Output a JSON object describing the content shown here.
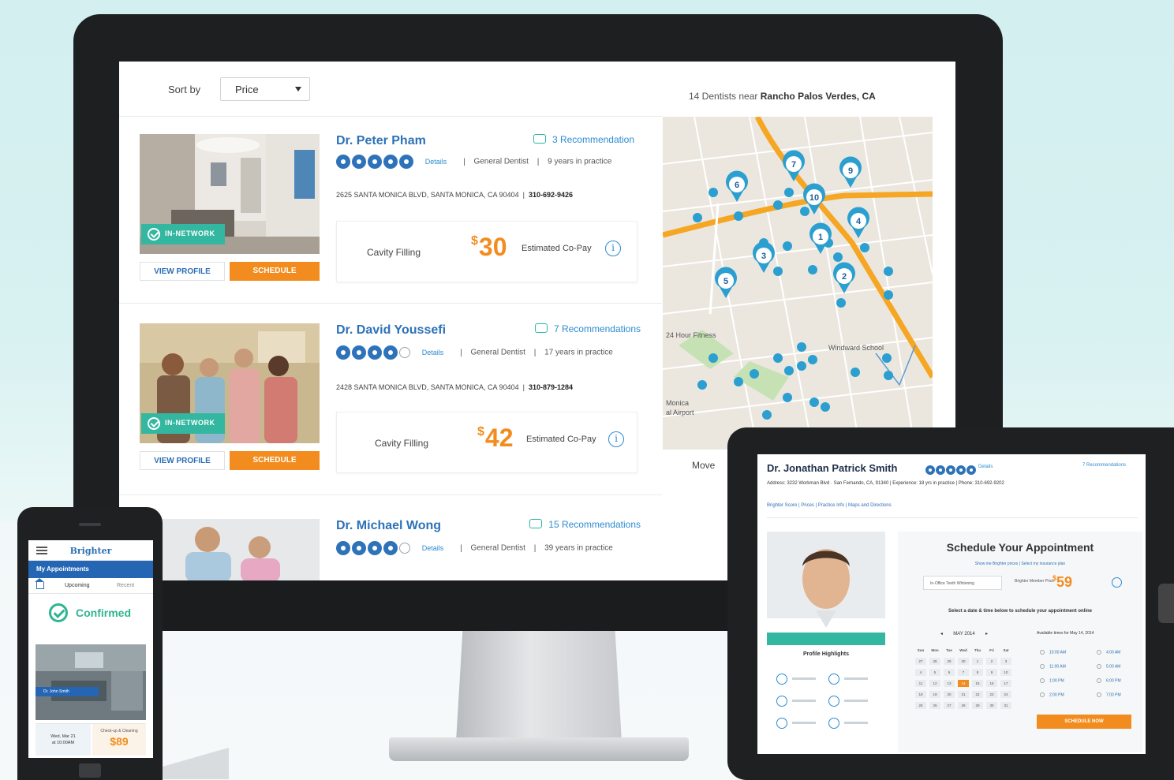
{
  "listing": {
    "sort_label": "Sort by",
    "sort_value": "Price",
    "results_prefix": "14 Dentists near",
    "results_location": "Rancho Palos Verdes, CA",
    "map_move_label": "Move",
    "view_profile_label": "VIEW PROFILE",
    "schedule_label": "SCHEDULE",
    "in_network_label": "IN-NETWORK",
    "details_label": "Details",
    "copay_label": "Estimated Co-Pay",
    "dentists": [
      {
        "name": "Dr. Peter Pham",
        "recommendations": "3 Recommendation",
        "rating": 5,
        "specialty": "General Dentist",
        "experience": "9 years in practice",
        "address": "2625 SANTA MONICA BLVD, SANTA MONICA, CA 90404",
        "phone": "310-692-9426",
        "service": "Cavity Filling",
        "currency": "$",
        "price": "30"
      },
      {
        "name": "Dr. David Youssefi",
        "recommendations": "7 Recommendations",
        "rating": 4,
        "specialty": "General Dentist",
        "experience": "17 years in practice",
        "address": "2428 SANTA MONICA BLVD, SANTA MONICA, CA 90404",
        "phone": "310-879-1284",
        "service": "Cavity Filling",
        "currency": "$",
        "price": "42"
      },
      {
        "name": "Dr. Michael Wong",
        "recommendations": "15 Recommendations",
        "rating": 4,
        "specialty": "General Dentist",
        "experience": "39 years in practice"
      }
    ],
    "map_pins": [
      "6",
      "7",
      "9",
      "10",
      "4",
      "1",
      "3",
      "2",
      "5"
    ],
    "map_labels": [
      "24 Hour Fitness",
      "Windward School",
      "Monica",
      "al Airport"
    ]
  },
  "phone": {
    "brand": "Brighter",
    "bar_title": "My Appointments",
    "tab_upcoming": "Upcoming",
    "tab_recent": "Recent",
    "status": "Confirmed",
    "doctor_tag": "Dr. John Smith",
    "date_line1": "Wed, Mar 21",
    "date_line2": "at 10:00AM",
    "deal_label": "Check-up & Cleaning",
    "deal_price": "$89"
  },
  "tablet": {
    "doctor_name": "Dr. Jonathan Patrick Smith",
    "details": "Details",
    "recommendations": "7 Recommendations",
    "meta": "Address: 3232 Workman Blvd · San Fernando, CA, 91340  |  Experience: 18 yrs in practice  |  Phone: 310-692-9202",
    "nav": "Brighter Score  |  Prices  |  Practice Info  |  Maps and Directions",
    "profile_highlights": "Profile Highlights",
    "schedule_title": "Schedule Your Appointment",
    "schedule_sub": "Show me Brighter prices  |  Select my insurance plan",
    "service_select": "In-Office Teeth Whitening",
    "price_label": "Brighter Member Price",
    "price": "59",
    "instructions": "Select a date & time below to schedule your appointment online",
    "month": "MAY 2014",
    "available_label": "Available times for May 14, 2014",
    "times": [
      "10:00 AM",
      "11:00 AM",
      "1:00 PM",
      "2:00 PM",
      "4:00 AM",
      "5:00 AM",
      "6:00 PM",
      "7:00 PM"
    ],
    "weekdays": [
      "Sun",
      "Mon",
      "Tue",
      "Wed",
      "Thu",
      "Fri",
      "Sat"
    ],
    "calendar_days": [
      "27",
      "28",
      "29",
      "30",
      "1",
      "2",
      "3",
      "4",
      "5",
      "6",
      "7",
      "8",
      "9",
      "10",
      "11",
      "12",
      "13",
      "14",
      "15",
      "16",
      "17",
      "18",
      "19",
      "20",
      "21",
      "22",
      "23",
      "24",
      "25",
      "26",
      "27",
      "28",
      "29",
      "30",
      "31"
    ],
    "selected_day": "14",
    "schedule_button": "SCHEDULE NOW"
  },
  "colors": {
    "brand_blue": "#2d72b8",
    "accent_orange": "#f28c1e",
    "network_green": "#34b7a0",
    "map_pin": "#2a9fd0",
    "road": "#f5a623"
  }
}
